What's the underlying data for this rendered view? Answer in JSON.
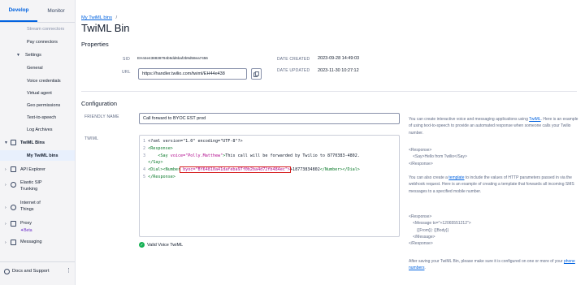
{
  "sidebar": {
    "tabs": [
      {
        "label": "Develop",
        "active": true
      },
      {
        "label": "Monitor",
        "active": false
      }
    ],
    "items": {
      "stream_connectors": "Stream connectors",
      "pay_connectors": "Pay connectors",
      "settings": "Settings",
      "general": "General",
      "voice_credentials": "Voice credentials",
      "virtual_agent": "Virtual agent",
      "geo_permissions": "Geo permissions",
      "text_to_speech": "Text-to-speech",
      "log_archives": "Log Archives",
      "twiml_bins": "TwiML Bins",
      "my_twiml_bins": "My TwiML bins",
      "api_explorer": "API Explorer",
      "elastic_sip_1": "Elastic SIP",
      "elastic_sip_2": "Trunking",
      "iot_1": "Internet of",
      "iot_2": "Things",
      "proxy": "Proxy",
      "beta": "Beta",
      "messaging": "Messaging"
    },
    "footer": {
      "label": "Docs and Support"
    }
  },
  "breadcrumb": {
    "link": "My TwiML bins",
    "sep": "/"
  },
  "page_title": "TwiML Bin",
  "properties": {
    "title": "Properties",
    "sid_label": "SID",
    "sid_value": "EH44e438838794b9dd6baf2b9d58ea7456",
    "url_label": "URL",
    "url_value": "https://handler.twilio.com/twiml/EH44e438",
    "date_created_label": "DATE CREATED",
    "date_created_value": "2023-09-28 14:49:03",
    "date_updated_label": "DATE UPDATED",
    "date_updated_value": "2023-11-30 10:27:12"
  },
  "configuration": {
    "title": "Configuration",
    "friendly_name_label": "FRIENDLY NAME",
    "friendly_name_value": "Call forward to BYOC EST prod",
    "twiml_label": "TWIML",
    "code_lines": {
      "l1_num": "1",
      "l1": "<?xml version=\"1.0\" encoding=\"UTF-8\"?>",
      "l2_num": "2",
      "l2": "<Response>",
      "l3_num": "3",
      "l3_tag": "<Say",
      "l3_attr": " voice=",
      "l3_str": "\"Polly.Matthew\"",
      "l3_gt": ">",
      "l3_text": "This call will be forwarded by Twilio to 8770383-4802.",
      "l3b": "</Say>",
      "l4_num": "4",
      "l4_tag": "<Dial><Number",
      "l4_hl": " byoc=\"BY64810a41dafeba97f0b2ba4d72fb484ec\">",
      "l4_text": "+18773834802",
      "l4_close": "</Number></Dial>",
      "l5_num": "5",
      "l5": "</Response>"
    },
    "valid_text": "Valid Voice TwiML"
  },
  "help": {
    "p1_pre": "You can create interactive voice and messaging applications using ",
    "p1_link": "TwiML",
    "p1_post": ". Here is an example of using text-to-speech to provide an automated response when someone calls your Twilio number.",
    "ex1_l1": "<Response>",
    "ex1_l2": "<Say>Hello from Twilio</Say>",
    "ex1_l3": "</Response>",
    "p2_pre": "You can also create a ",
    "p2_link": "template",
    "p2_post": " to include the values of HTTP parameters passed in via the webhook request. Here is an example of creating a template that forwards all incoming SMS messages to a specified mobile number.",
    "ex2_l1": "<Response>",
    "ex2_l2": "<Message to=\"+12065551212\">",
    "ex2_l3": "{{From}}: {{Body}}",
    "ex2_l4": "</Message>",
    "ex2_l5": "</Response>",
    "p3_pre": "After saving your TwiML Bin, please make sure it is configured on one or more of your ",
    "p3_link": "phone numbers",
    "p3_post": "."
  },
  "colors": {
    "accent": "#0263e0",
    "valid": "#14b053",
    "highlight": "#d61f1f"
  }
}
